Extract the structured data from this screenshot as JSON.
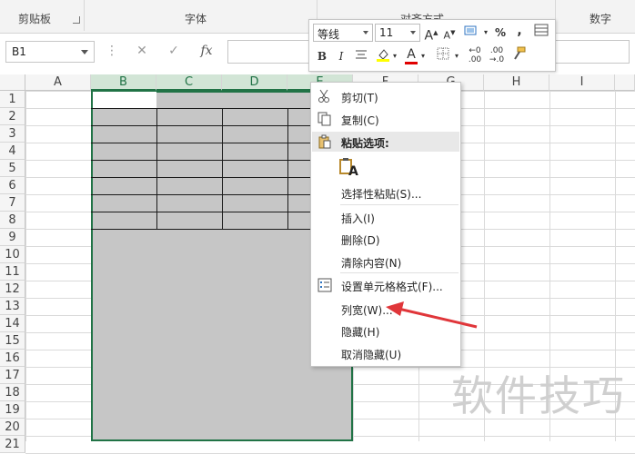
{
  "ribbon": {
    "groups": [
      "剪贴板",
      "字体",
      "对齐方式",
      "数字"
    ]
  },
  "formula_bar": {
    "name_box": "B1",
    "cancel_icon": "✕",
    "enter_icon": "✓",
    "fx_label": "fx",
    "dots": "⋮"
  },
  "grid": {
    "columns": [
      "A",
      "B",
      "C",
      "D",
      "E",
      "F",
      "G",
      "H",
      "I"
    ],
    "rows": [
      "1",
      "2",
      "3",
      "4",
      "5",
      "6",
      "7",
      "8",
      "9",
      "10",
      "11",
      "12",
      "13",
      "14",
      "15",
      "16",
      "17",
      "18",
      "19",
      "20",
      "21"
    ]
  },
  "mini_toolbar": {
    "font_name": "等线",
    "font_size": "11",
    "grow": "A",
    "shrink": "A",
    "percent": "%",
    "comma": ",",
    "bold": "B",
    "italic": "I",
    "font_color_letter": "A",
    "dec_inc": "←.0",
    "dec_dec": ".00",
    "accent": "#217346",
    "fill_color": "#ffff00",
    "font_color": "#e00000"
  },
  "context_menu": {
    "items": [
      {
        "label": "剪切(T)"
      },
      {
        "label": "复制(C)"
      },
      {
        "label": "粘贴选项:"
      },
      {
        "label": "A"
      },
      {
        "label": "选择性粘贴(S)..."
      },
      {
        "label": "插入(I)"
      },
      {
        "label": "删除(D)"
      },
      {
        "label": "清除内容(N)"
      },
      {
        "label": "设置单元格格式(F)..."
      },
      {
        "label": "列宽(W)..."
      },
      {
        "label": "隐藏(H)"
      },
      {
        "label": "取消隐藏(U)"
      }
    ]
  },
  "watermark": "软件技巧",
  "annotation_color": "#e0363a"
}
